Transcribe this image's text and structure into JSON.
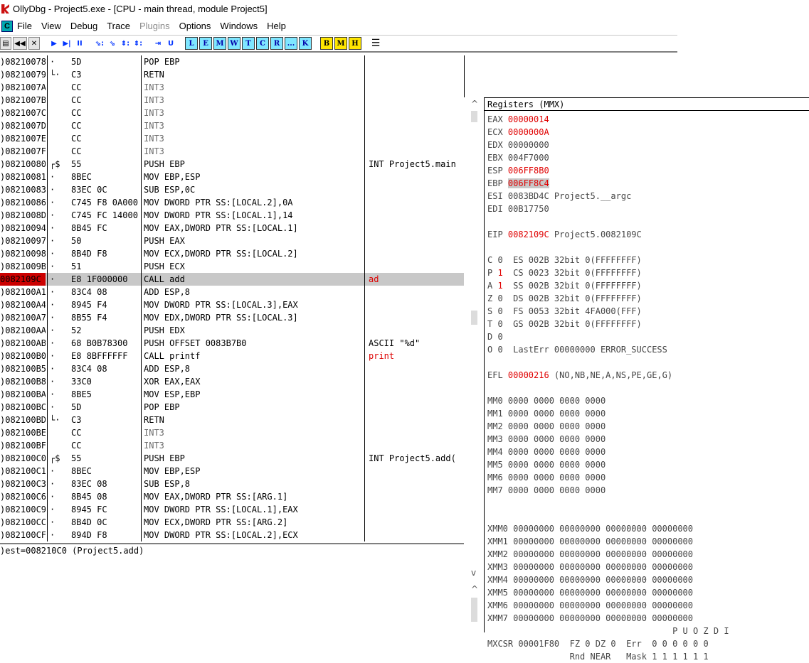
{
  "window": {
    "title": "OllyDbg - Project5.exe - [CPU - main thread, module Project5]"
  },
  "menu": {
    "items": [
      {
        "label": "File"
      },
      {
        "label": "View"
      },
      {
        "label": "Debug"
      },
      {
        "label": "Trace"
      },
      {
        "label": "Plugins",
        "disabled": true
      },
      {
        "label": "Options"
      },
      {
        "label": "Windows"
      },
      {
        "label": "Help"
      }
    ],
    "cpu_icon": "C"
  },
  "toolbar": {
    "nav_buttons": [
      "◀◀",
      "✕"
    ],
    "run_buttons": [
      "▶",
      "▶|",
      "II"
    ],
    "step_buttons": [
      "⇘:",
      "⇘",
      "⇟:",
      "⇟:"
    ],
    "trace_buttons": [
      "⇥",
      "U"
    ],
    "window_buttons": [
      "L",
      "E",
      "M",
      "W",
      "T",
      "C",
      "R",
      "...",
      "K"
    ],
    "yellow_buttons": [
      "B",
      "M",
      "H"
    ],
    "list_icon": "☰"
  },
  "colors": {
    "accent_red": "#e00000",
    "selected_row": "#c8c8c8",
    "toolbar_cyan": "#7fe7ff",
    "toolbar_yellow": "#ffe600"
  },
  "disasm": {
    "rows": [
      {
        "addr": ")08210078",
        "mark": "·",
        "hex": "5D",
        "asm": "POP EBP",
        "cmt": ""
      },
      {
        "addr": ")08210079",
        "mark": "└·",
        "hex": "C3",
        "asm": "RETN",
        "cmt": ""
      },
      {
        "addr": ")0821007A",
        "mark": "",
        "hex": "CC",
        "asm": "INT3",
        "cmt": "",
        "int3": true
      },
      {
        "addr": ")0821007B",
        "mark": "",
        "hex": "CC",
        "asm": "INT3",
        "cmt": "",
        "int3": true
      },
      {
        "addr": ")0821007C",
        "mark": "",
        "hex": "CC",
        "asm": "INT3",
        "cmt": "",
        "int3": true
      },
      {
        "addr": ")0821007D",
        "mark": "",
        "hex": "CC",
        "asm": "INT3",
        "cmt": "",
        "int3": true
      },
      {
        "addr": ")0821007E",
        "mark": "",
        "hex": "CC",
        "asm": "INT3",
        "cmt": "",
        "int3": true
      },
      {
        "addr": ")0821007F",
        "mark": "",
        "hex": "CC",
        "asm": "INT3",
        "cmt": "",
        "int3": true
      },
      {
        "addr": ")08210080",
        "mark": "┌$",
        "hex": "55",
        "asm": "PUSH EBP",
        "cmt": "INT Project5.main"
      },
      {
        "addr": ")08210081",
        "mark": "·",
        "hex": "8BEC",
        "asm": "MOV EBP,ESP",
        "cmt": ""
      },
      {
        "addr": ")08210083",
        "mark": "·",
        "hex": "83EC 0C",
        "asm": "SUB ESP,0C",
        "cmt": ""
      },
      {
        "addr": ")08210086",
        "mark": "·",
        "hex": "C745 F8 0A000",
        "asm": "MOV DWORD PTR SS:[LOCAL.2],0A",
        "cmt": ""
      },
      {
        "addr": ")0821008D",
        "mark": "·",
        "hex": "C745 FC 14000",
        "asm": "MOV DWORD PTR SS:[LOCAL.1],14",
        "cmt": ""
      },
      {
        "addr": ")08210094",
        "mark": "·",
        "hex": "8B45 FC",
        "asm": "MOV EAX,DWORD PTR SS:[LOCAL.1]",
        "cmt": ""
      },
      {
        "addr": ")08210097",
        "mark": "·",
        "hex": "50",
        "asm": "PUSH EAX",
        "cmt": ""
      },
      {
        "addr": ")08210098",
        "mark": "·",
        "hex": "8B4D F8",
        "asm": "MOV ECX,DWORD PTR SS:[LOCAL.2]",
        "cmt": ""
      },
      {
        "addr": ")0821009B",
        "mark": "·",
        "hex": "51",
        "asm": "PUSH ECX",
        "cmt": ""
      },
      {
        "addr": "0082109C",
        "mark": "·",
        "hex": "E8 1F000000",
        "asm": "CALL add",
        "cmt": "ad",
        "selected": true,
        "addr_highlight": true,
        "cmt_red": true
      },
      {
        "addr": ")082100A1",
        "mark": "·",
        "hex": "83C4 08",
        "asm": "ADD ESP,8",
        "cmt": ""
      },
      {
        "addr": ")082100A4",
        "mark": "·",
        "hex": "8945 F4",
        "asm": "MOV DWORD PTR SS:[LOCAL.3],EAX",
        "cmt": ""
      },
      {
        "addr": ")082100A7",
        "mark": "·",
        "hex": "8B55 F4",
        "asm": "MOV EDX,DWORD PTR SS:[LOCAL.3]",
        "cmt": ""
      },
      {
        "addr": ")082100AA",
        "mark": "·",
        "hex": "52",
        "asm": "PUSH EDX",
        "cmt": ""
      },
      {
        "addr": ")082100AB",
        "mark": "·",
        "hex": "68 B0B78300",
        "asm": "PUSH OFFSET 0083B7B0",
        "cmt": "ASCII \"%d\""
      },
      {
        "addr": ")082100B0",
        "mark": "·",
        "hex": "E8 8BFFFFFF",
        "asm": "CALL printf",
        "cmt": "print",
        "cmt_red": true
      },
      {
        "addr": ")082100B5",
        "mark": "·",
        "hex": "83C4 08",
        "asm": "ADD ESP,8",
        "cmt": ""
      },
      {
        "addr": ")082100B8",
        "mark": "·",
        "hex": "33C0",
        "asm": "XOR EAX,EAX",
        "cmt": ""
      },
      {
        "addr": ")082100BA",
        "mark": "·",
        "hex": "8BE5",
        "asm": "MOV ESP,EBP",
        "cmt": ""
      },
      {
        "addr": ")082100BC",
        "mark": "·",
        "hex": "5D",
        "asm": "POP EBP",
        "cmt": ""
      },
      {
        "addr": ")082100BD",
        "mark": "└·",
        "hex": "C3",
        "asm": "RETN",
        "cmt": ""
      },
      {
        "addr": ")082100BE",
        "mark": "",
        "hex": "CC",
        "asm": "INT3",
        "cmt": "",
        "int3": true
      },
      {
        "addr": ")082100BF",
        "mark": "",
        "hex": "CC",
        "asm": "INT3",
        "cmt": "",
        "int3": true
      },
      {
        "addr": ")082100C0",
        "mark": "┌$",
        "hex": "55",
        "asm": "PUSH EBP",
        "cmt": "INT Project5.add("
      },
      {
        "addr": ")082100C1",
        "mark": "·",
        "hex": "8BEC",
        "asm": "MOV EBP,ESP",
        "cmt": ""
      },
      {
        "addr": ")082100C3",
        "mark": "·",
        "hex": "83EC 08",
        "asm": "SUB ESP,8",
        "cmt": ""
      },
      {
        "addr": ")082100C6",
        "mark": "·",
        "hex": "8B45 08",
        "asm": "MOV EAX,DWORD PTR SS:[ARG.1]",
        "cmt": ""
      },
      {
        "addr": ")082100C9",
        "mark": "·",
        "hex": "8945 FC",
        "asm": "MOV DWORD PTR SS:[LOCAL.1],EAX",
        "cmt": ""
      },
      {
        "addr": ")082100CC",
        "mark": "·",
        "hex": "8B4D 0C",
        "asm": "MOV ECX,DWORD PTR SS:[ARG.2]",
        "cmt": ""
      },
      {
        "addr": ")082100CF",
        "mark": "·",
        "hex": "894D F8",
        "asm": "MOV DWORD PTR SS:[LOCAL.2],ECX",
        "cmt": ""
      }
    ],
    "status": ")est=008210C0 (Project5.add)"
  },
  "registers": {
    "title": "Registers (MMX)",
    "lines": [
      {
        "pre": "EAX ",
        "val": "00000014",
        "style": "red",
        "post": ""
      },
      {
        "pre": "ECX ",
        "val": "0000000A",
        "style": "red",
        "post": ""
      },
      {
        "pre": "EDX ",
        "val": "00000000",
        "style": "",
        "post": ""
      },
      {
        "pre": "EBX ",
        "val": "004F7000",
        "style": "",
        "post": ""
      },
      {
        "pre": "ESP ",
        "val": "006FF8B0",
        "style": "red",
        "post": ""
      },
      {
        "pre": "EBP ",
        "val": "006FF8C4",
        "style": "hl",
        "post": ""
      },
      {
        "pre": "ESI ",
        "val": "0083BD4C",
        "style": "",
        "post": " Project5.__argc"
      },
      {
        "pre": "EDI ",
        "val": "00B17750",
        "style": "",
        "post": ""
      },
      {
        "pre": "",
        "val": "",
        "style": "",
        "post": ""
      },
      {
        "pre": "EIP ",
        "val": "0082109C",
        "style": "red",
        "post": " Project5.0082109C"
      },
      {
        "pre": "",
        "val": "",
        "style": "",
        "post": ""
      },
      {
        "pre": "C ",
        "val": "0",
        "style": "",
        "post": "  ES 002B 32bit 0(FFFFFFFF)"
      },
      {
        "pre": "P ",
        "val": "1",
        "style": "red",
        "post": "  CS 0023 32bit 0(FFFFFFFF)"
      },
      {
        "pre": "A ",
        "val": "1",
        "style": "red",
        "post": "  SS 002B 32bit 0(FFFFFFFF)"
      },
      {
        "pre": "Z ",
        "val": "0",
        "style": "",
        "post": "  DS 002B 32bit 0(FFFFFFFF)"
      },
      {
        "pre": "S ",
        "val": "0",
        "style": "",
        "post": "  FS 0053 32bit 4FA000(FFF)"
      },
      {
        "pre": "T ",
        "val": "0",
        "style": "",
        "post": "  GS 002B 32bit 0(FFFFFFFF)"
      },
      {
        "pre": "D ",
        "val": "0",
        "style": "",
        "post": ""
      },
      {
        "pre": "O ",
        "val": "0",
        "style": "",
        "post": "  LastErr 00000000 ERROR_SUCCESS"
      },
      {
        "pre": "",
        "val": "",
        "style": "",
        "post": ""
      },
      {
        "pre": "EFL ",
        "val": "00000216",
        "style": "red",
        "post": " (NO,NB,NE,A,NS,PE,GE,G)"
      },
      {
        "pre": "",
        "val": "",
        "style": "",
        "post": ""
      },
      {
        "pre": "MM0 ",
        "val": "0000 0000 0000 0000",
        "style": "",
        "post": ""
      },
      {
        "pre": "MM1 ",
        "val": "0000 0000 0000 0000",
        "style": "",
        "post": ""
      },
      {
        "pre": "MM2 ",
        "val": "0000 0000 0000 0000",
        "style": "",
        "post": ""
      },
      {
        "pre": "MM3 ",
        "val": "0000 0000 0000 0000",
        "style": "",
        "post": ""
      },
      {
        "pre": "MM4 ",
        "val": "0000 0000 0000 0000",
        "style": "",
        "post": ""
      },
      {
        "pre": "MM5 ",
        "val": "0000 0000 0000 0000",
        "style": "",
        "post": ""
      },
      {
        "pre": "MM6 ",
        "val": "0000 0000 0000 0000",
        "style": "",
        "post": ""
      },
      {
        "pre": "MM7 ",
        "val": "0000 0000 0000 0000",
        "style": "",
        "post": ""
      },
      {
        "pre": "",
        "val": "",
        "style": "",
        "post": ""
      },
      {
        "pre": "",
        "val": "",
        "style": "",
        "post": ""
      },
      {
        "pre": "XMM0 ",
        "val": "00000000 00000000 00000000 00000000",
        "style": "",
        "post": ""
      },
      {
        "pre": "XMM1 ",
        "val": "00000000 00000000 00000000 00000000",
        "style": "",
        "post": ""
      },
      {
        "pre": "XMM2 ",
        "val": "00000000 00000000 00000000 00000000",
        "style": "",
        "post": ""
      },
      {
        "pre": "XMM3 ",
        "val": "00000000 00000000 00000000 00000000",
        "style": "",
        "post": ""
      },
      {
        "pre": "XMM4 ",
        "val": "00000000 00000000 00000000 00000000",
        "style": "",
        "post": ""
      },
      {
        "pre": "XMM5 ",
        "val": "00000000 00000000 00000000 00000000",
        "style": "",
        "post": ""
      },
      {
        "pre": "XMM6 ",
        "val": "00000000 00000000 00000000 00000000",
        "style": "",
        "post": ""
      },
      {
        "pre": "XMM7 ",
        "val": "00000000 00000000 00000000 00000000",
        "style": "",
        "post": ""
      },
      {
        "pre": "",
        "val": "",
        "style": "",
        "post": "                                    P U O Z D I"
      },
      {
        "pre": "MXCSR ",
        "val": "00001F80",
        "style": "",
        "post": "  FZ 0 DZ 0  Err  0 0 0 0 0 0"
      },
      {
        "pre": "",
        "val": "",
        "style": "",
        "post": "                Rnd NEAR   Mask 1 1 1 1 1 1"
      }
    ]
  }
}
